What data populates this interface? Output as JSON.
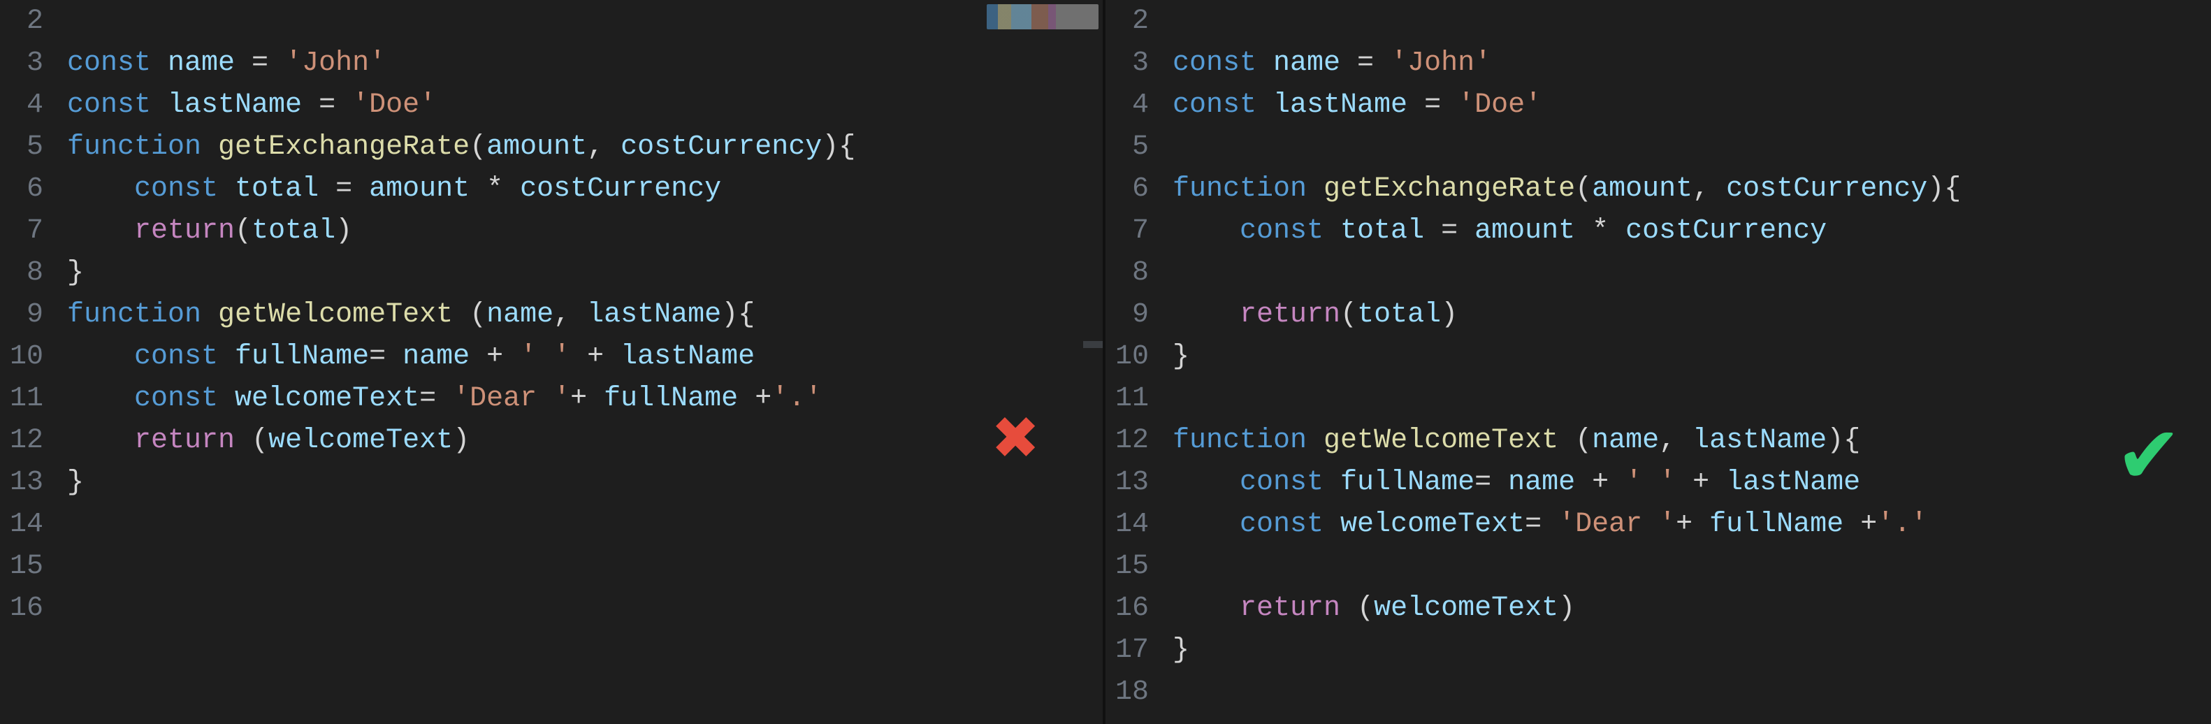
{
  "colors": {
    "background": "#1e1e1e",
    "gutter": "#6e7681",
    "keyword": "#569cd6",
    "function": "#dcdcaa",
    "variable": "#9cdcfe",
    "string": "#ce9178",
    "return": "#c586c0",
    "default": "#d4d4d4",
    "cross": "#e74c3c",
    "check": "#2ecc71"
  },
  "left": {
    "badge": "cross",
    "lines": [
      {
        "n": "2",
        "tokens": []
      },
      {
        "n": "3",
        "tokens": [
          [
            "kw",
            "const "
          ],
          [
            "var",
            "name"
          ],
          [
            "op",
            " = "
          ],
          [
            "str",
            "'John'"
          ]
        ]
      },
      {
        "n": "4",
        "tokens": [
          [
            "kw",
            "const "
          ],
          [
            "var",
            "lastName"
          ],
          [
            "op",
            " = "
          ],
          [
            "str",
            "'Doe'"
          ]
        ]
      },
      {
        "n": "5",
        "tokens": [
          [
            "kw",
            "function "
          ],
          [
            "fn",
            "getExchangeRate"
          ],
          [
            "punc",
            "("
          ],
          [
            "param",
            "amount"
          ],
          [
            "punc",
            ", "
          ],
          [
            "param",
            "costCurrency"
          ],
          [
            "punc",
            "){"
          ]
        ]
      },
      {
        "n": "6",
        "tokens": [
          [
            "punc",
            "    "
          ],
          [
            "kw",
            "const "
          ],
          [
            "var",
            "total"
          ],
          [
            "op",
            " = "
          ],
          [
            "var",
            "amount"
          ],
          [
            "op",
            " * "
          ],
          [
            "var",
            "costCurrency"
          ]
        ]
      },
      {
        "n": "7",
        "tokens": [
          [
            "punc",
            "    "
          ],
          [
            "ret",
            "return"
          ],
          [
            "punc",
            "("
          ],
          [
            "var",
            "total"
          ],
          [
            "punc",
            ")"
          ]
        ]
      },
      {
        "n": "8",
        "tokens": [
          [
            "punc",
            "}"
          ]
        ]
      },
      {
        "n": "9",
        "tokens": [
          [
            "kw",
            "function "
          ],
          [
            "fn",
            "getWelcomeText"
          ],
          [
            "punc",
            " ("
          ],
          [
            "param",
            "name"
          ],
          [
            "punc",
            ", "
          ],
          [
            "param",
            "lastName"
          ],
          [
            "punc",
            "){"
          ]
        ]
      },
      {
        "n": "10",
        "tokens": [
          [
            "punc",
            "    "
          ],
          [
            "kw",
            "const "
          ],
          [
            "var",
            "fullName"
          ],
          [
            "op",
            "= "
          ],
          [
            "var",
            "name"
          ],
          [
            "op",
            " + "
          ],
          [
            "str",
            "' '"
          ],
          [
            "op",
            " + "
          ],
          [
            "var",
            "lastName"
          ]
        ]
      },
      {
        "n": "11",
        "tokens": [
          [
            "punc",
            "    "
          ],
          [
            "kw",
            "const "
          ],
          [
            "var",
            "welcomeText"
          ],
          [
            "op",
            "= "
          ],
          [
            "str",
            "'Dear '"
          ],
          [
            "op",
            "+ "
          ],
          [
            "var",
            "fullName"
          ],
          [
            "op",
            " +"
          ],
          [
            "str",
            "'.'"
          ]
        ]
      },
      {
        "n": "12",
        "tokens": [
          [
            "punc",
            "    "
          ],
          [
            "ret",
            "return"
          ],
          [
            "punc",
            " ("
          ],
          [
            "var",
            "welcomeText"
          ],
          [
            "punc",
            ")"
          ]
        ]
      },
      {
        "n": "13",
        "tokens": [
          [
            "punc",
            "}"
          ]
        ]
      },
      {
        "n": "14",
        "tokens": []
      },
      {
        "n": "15",
        "tokens": []
      },
      {
        "n": "16",
        "tokens": []
      }
    ]
  },
  "right": {
    "badge": "check",
    "lines": [
      {
        "n": "2",
        "tokens": []
      },
      {
        "n": "3",
        "tokens": [
          [
            "kw",
            "const "
          ],
          [
            "var",
            "name"
          ],
          [
            "op",
            " = "
          ],
          [
            "str",
            "'John'"
          ]
        ]
      },
      {
        "n": "4",
        "tokens": [
          [
            "kw",
            "const "
          ],
          [
            "var",
            "lastName"
          ],
          [
            "op",
            " = "
          ],
          [
            "str",
            "'Doe'"
          ]
        ]
      },
      {
        "n": "5",
        "tokens": []
      },
      {
        "n": "6",
        "tokens": [
          [
            "kw",
            "function "
          ],
          [
            "fn",
            "getExchangeRate"
          ],
          [
            "punc",
            "("
          ],
          [
            "param",
            "amount"
          ],
          [
            "punc",
            ", "
          ],
          [
            "param",
            "costCurrency"
          ],
          [
            "punc",
            "){"
          ]
        ]
      },
      {
        "n": "7",
        "tokens": [
          [
            "punc",
            "    "
          ],
          [
            "kw",
            "const "
          ],
          [
            "var",
            "total"
          ],
          [
            "op",
            " = "
          ],
          [
            "var",
            "amount"
          ],
          [
            "op",
            " * "
          ],
          [
            "var",
            "costCurrency"
          ]
        ]
      },
      {
        "n": "8",
        "tokens": []
      },
      {
        "n": "9",
        "tokens": [
          [
            "punc",
            "    "
          ],
          [
            "ret",
            "return"
          ],
          [
            "punc",
            "("
          ],
          [
            "var",
            "total"
          ],
          [
            "punc",
            ")"
          ]
        ]
      },
      {
        "n": "10",
        "tokens": [
          [
            "punc",
            "}"
          ]
        ]
      },
      {
        "n": "11",
        "tokens": []
      },
      {
        "n": "12",
        "tokens": [
          [
            "kw",
            "function "
          ],
          [
            "fn",
            "getWelcomeText"
          ],
          [
            "punc",
            " ("
          ],
          [
            "param",
            "name"
          ],
          [
            "punc",
            ", "
          ],
          [
            "param",
            "lastName"
          ],
          [
            "punc",
            "){"
          ]
        ]
      },
      {
        "n": "13",
        "tokens": [
          [
            "punc",
            "    "
          ],
          [
            "kw",
            "const "
          ],
          [
            "var",
            "fullName"
          ],
          [
            "op",
            "= "
          ],
          [
            "var",
            "name"
          ],
          [
            "op",
            " + "
          ],
          [
            "str",
            "' '"
          ],
          [
            "op",
            " + "
          ],
          [
            "var",
            "lastName"
          ]
        ]
      },
      {
        "n": "14",
        "tokens": [
          [
            "punc",
            "    "
          ],
          [
            "kw",
            "const "
          ],
          [
            "var",
            "welcomeText"
          ],
          [
            "op",
            "= "
          ],
          [
            "str",
            "'Dear '"
          ],
          [
            "op",
            "+ "
          ],
          [
            "var",
            "fullName"
          ],
          [
            "op",
            " +"
          ],
          [
            "str",
            "'.'"
          ]
        ]
      },
      {
        "n": "15",
        "tokens": []
      },
      {
        "n": "16",
        "tokens": [
          [
            "punc",
            "    "
          ],
          [
            "ret",
            "return"
          ],
          [
            "punc",
            " ("
          ],
          [
            "var",
            "welcomeText"
          ],
          [
            "punc",
            ")"
          ]
        ]
      },
      {
        "n": "17",
        "tokens": [
          [
            "punc",
            "}"
          ]
        ]
      },
      {
        "n": "18",
        "tokens": []
      }
    ]
  },
  "glyphs": {
    "cross": "✖",
    "check": "✔"
  }
}
